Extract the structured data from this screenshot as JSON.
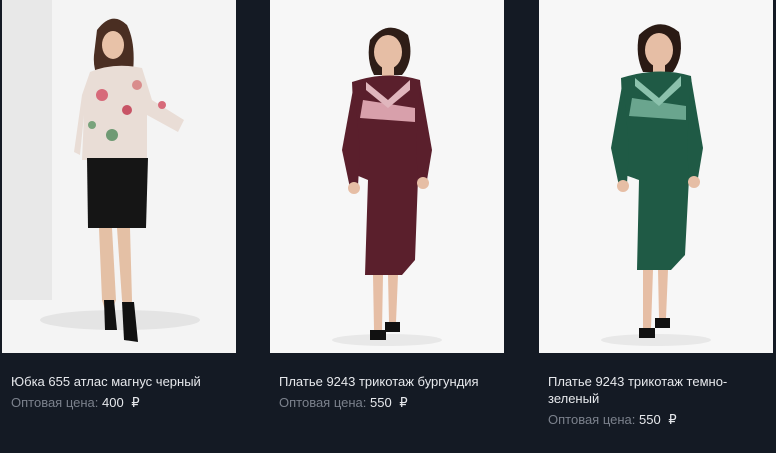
{
  "products": [
    {
      "title": "Юбка 655 атлас магнус черный",
      "price_label": "Оптовая цена:",
      "price_value": "400",
      "currency": "₽"
    },
    {
      "title": "Платье 9243 трикотаж бургундия",
      "price_label": "Оптовая цена:",
      "price_value": "550",
      "currency": "₽"
    },
    {
      "title": "Платье 9243 трикотаж темно-зеленый",
      "price_label": "Оптовая цена:",
      "price_value": "550",
      "currency": "₽"
    }
  ],
  "colors": {
    "background": "#141a24",
    "title_text": "#e6e8ec",
    "price_label": "#7b818c",
    "dress_burgundy": "#5a1f2c",
    "dress_green": "#1f5a45",
    "skirt_black": "#151515"
  }
}
